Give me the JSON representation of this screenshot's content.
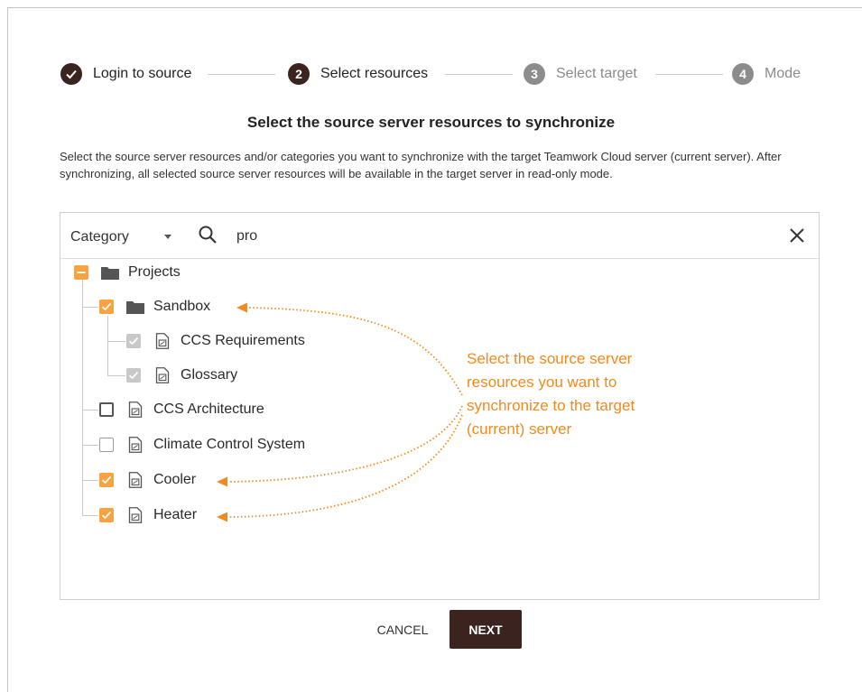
{
  "stepper": {
    "steps": [
      {
        "number": "1",
        "label": "Login to source",
        "state": "done"
      },
      {
        "number": "2",
        "label": "Select resources",
        "state": "active"
      },
      {
        "number": "3",
        "label": "Select target",
        "state": "inactive"
      },
      {
        "number": "4",
        "label": "Mode",
        "state": "inactive"
      }
    ]
  },
  "title": "Select the source server resources to synchronize",
  "description": "Select the source server resources and/or categories you want to synchronize with the target Teamwork Cloud server (current server). After synchronizing, all selected source server resources will be available in the target server in read-only mode.",
  "search": {
    "filter_label": "Category",
    "query": "pro"
  },
  "tree": {
    "items": [
      {
        "label": "Projects",
        "type": "folder",
        "check": "indeterminate"
      },
      {
        "label": "Sandbox",
        "type": "folder",
        "check": "checked"
      },
      {
        "label": "CCS Requirements",
        "type": "project",
        "check": "checked-disabled"
      },
      {
        "label": "Glossary",
        "type": "project",
        "check": "checked-disabled"
      },
      {
        "label": "CCS Architecture",
        "type": "project",
        "check": "unchecked"
      },
      {
        "label": "Climate Control System",
        "type": "project",
        "check": "unchecked"
      },
      {
        "label": "Cooler",
        "type": "project",
        "check": "checked"
      },
      {
        "label": "Heater",
        "type": "project",
        "check": "checked"
      }
    ]
  },
  "annotation": {
    "lines": [
      "Select the source server",
      "resources you want to",
      "synchronize to the target",
      "(current) server"
    ]
  },
  "buttons": {
    "cancel": "CANCEL",
    "next": "NEXT"
  },
  "colors": {
    "primary": "#3b2420",
    "accent": "#f8a340",
    "annotation": "#f28a1c",
    "inactive": "#8c8c8c"
  }
}
